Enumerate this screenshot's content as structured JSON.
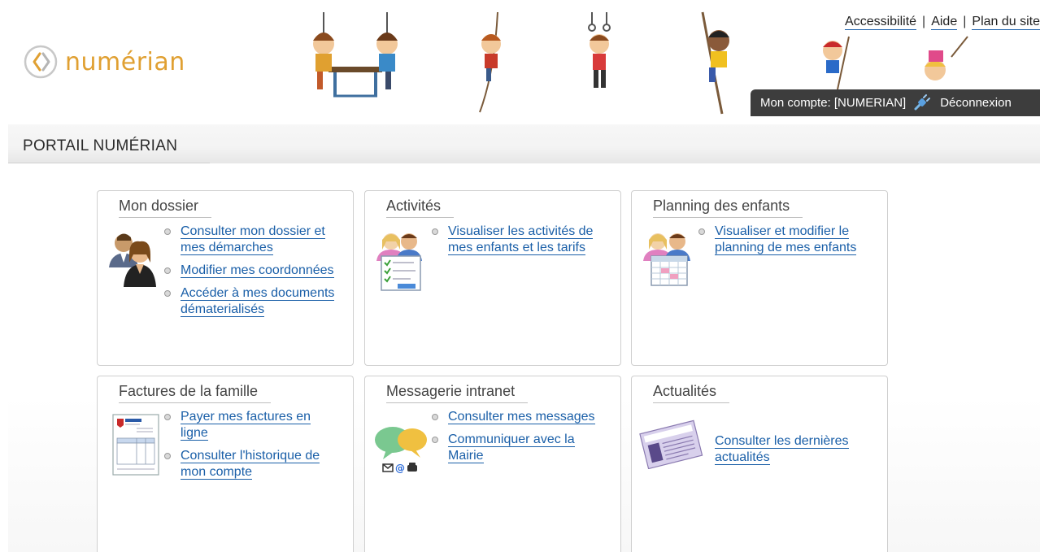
{
  "brand": {
    "logo_text": "numérian"
  },
  "top_links": [
    "Accessibilité",
    "Aide",
    "Plan du site"
  ],
  "account": {
    "label": "Mon compte: [NUMERIAN]",
    "logout": "Déconnexion"
  },
  "portal": {
    "title": "PORTAIL NUMÉRIAN"
  },
  "colors": {
    "accent": "#1a5fa8",
    "logo": "#e0a032",
    "account_bar": "#3d3d3d"
  },
  "cards": [
    {
      "title": "Mon dossier",
      "icon": "users-icon",
      "links": [
        "Consulter mon dossier et mes démarches",
        "Modifier mes coordonnées",
        "Accéder à mes documents dématerialisés"
      ]
    },
    {
      "title": "Activités",
      "icon": "activities-icon",
      "links": [
        "Visualiser les activités de mes enfants et les tarifs"
      ]
    },
    {
      "title": "Planning des enfants",
      "icon": "planning-icon",
      "links": [
        "Visualiser et modifier le planning de mes enfants"
      ]
    },
    {
      "title": "Factures de la famille",
      "icon": "invoice-icon",
      "links": [
        "Payer mes factures en ligne",
        "Consulter l'historique de mon compte"
      ]
    },
    {
      "title": "Messagerie intranet",
      "icon": "messaging-icon",
      "links": [
        "Consulter mes messages",
        "Communiquer avec la Mairie"
      ]
    },
    {
      "title": "Actualités",
      "icon": "news-icon",
      "links": [
        "Consulter les dernières actualités"
      ]
    }
  ]
}
